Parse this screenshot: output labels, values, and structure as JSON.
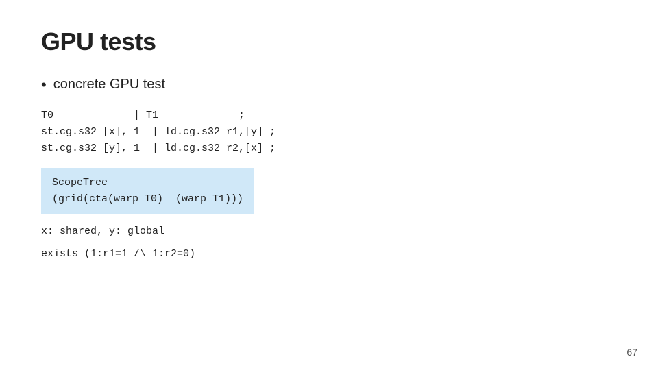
{
  "slide": {
    "title": "GPU tests",
    "bullet": "concrete GPU test",
    "code_table": "T0             | T1             ;\nst.cg.s32 [x], 1  | ld.cg.s32 r1,[y] ;\nst.cg.s32 [y], 1  | ld.cg.s32 r2,[x] ;",
    "scope_tree_label": "ScopeTree",
    "scope_tree_content": "(grid(cta(warp T0)  (warp T1)))",
    "shared_global": "x: shared, y: global",
    "exists_line": "exists (1:r1=1 /\\ 1:r2=0)",
    "page_number": "67"
  }
}
